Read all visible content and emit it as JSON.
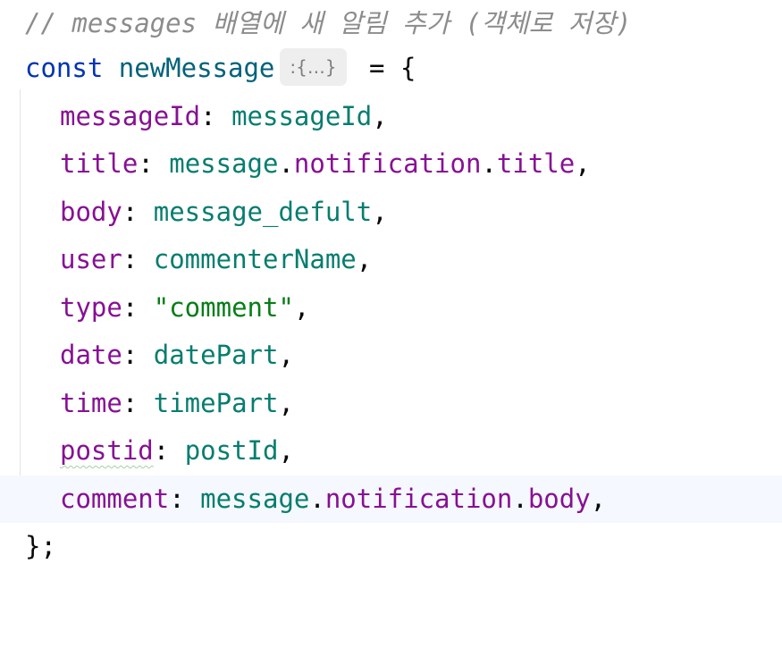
{
  "editor": {
    "language": "javascript",
    "comment": "// messages 배열에 새 알림 추가 (객체로 저장)",
    "decl": {
      "keyword": "const",
      "name": "newMessage",
      "hint": ":{…}",
      "assign": " = {"
    },
    "fields": [
      {
        "key": "messageId",
        "value": "messageId",
        "kind": "ident"
      },
      {
        "key": "title",
        "value": "message.notification.title",
        "kind": "member"
      },
      {
        "key": "body",
        "value": "message_defult",
        "kind": "ident"
      },
      {
        "key": "user",
        "value": "commenterName",
        "kind": "ident"
      },
      {
        "key": "type",
        "value": "\"comment\"",
        "kind": "string"
      },
      {
        "key": "date",
        "value": "datePart",
        "kind": "ident"
      },
      {
        "key": "time",
        "value": "timePart",
        "kind": "ident"
      },
      {
        "key": "postid",
        "value": "postId",
        "kind": "ident",
        "warning": true
      },
      {
        "key": "comment",
        "value": "message.notification.body",
        "kind": "member",
        "current": true
      }
    ],
    "closing": "};",
    "colors": {
      "keyword": "#0033b3",
      "declaration": "#00627a",
      "property": "#871094",
      "identifier": "#067d6f",
      "string": "#067d17",
      "comment": "#8c8c8c",
      "current_line": "#f5f8fe"
    }
  }
}
